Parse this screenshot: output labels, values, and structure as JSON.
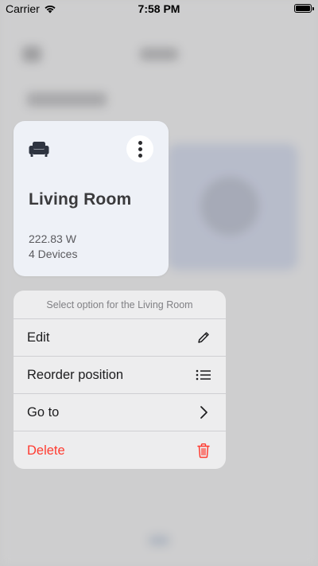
{
  "status_bar": {
    "carrier": "Carrier",
    "time": "7:58 PM"
  },
  "room_card": {
    "icon": "sofa-icon",
    "name": "Living Room",
    "power": "222.83 W",
    "devices": "4 Devices"
  },
  "context_menu": {
    "title": "Select option for the Living Room",
    "items": [
      {
        "label": "Edit",
        "icon": "pencil-icon"
      },
      {
        "label": "Reorder position",
        "icon": "list-icon"
      },
      {
        "label": "Go to",
        "icon": "chevron-right-icon"
      },
      {
        "label": "Delete",
        "icon": "trash-icon",
        "color": "#ff3b30"
      }
    ]
  }
}
